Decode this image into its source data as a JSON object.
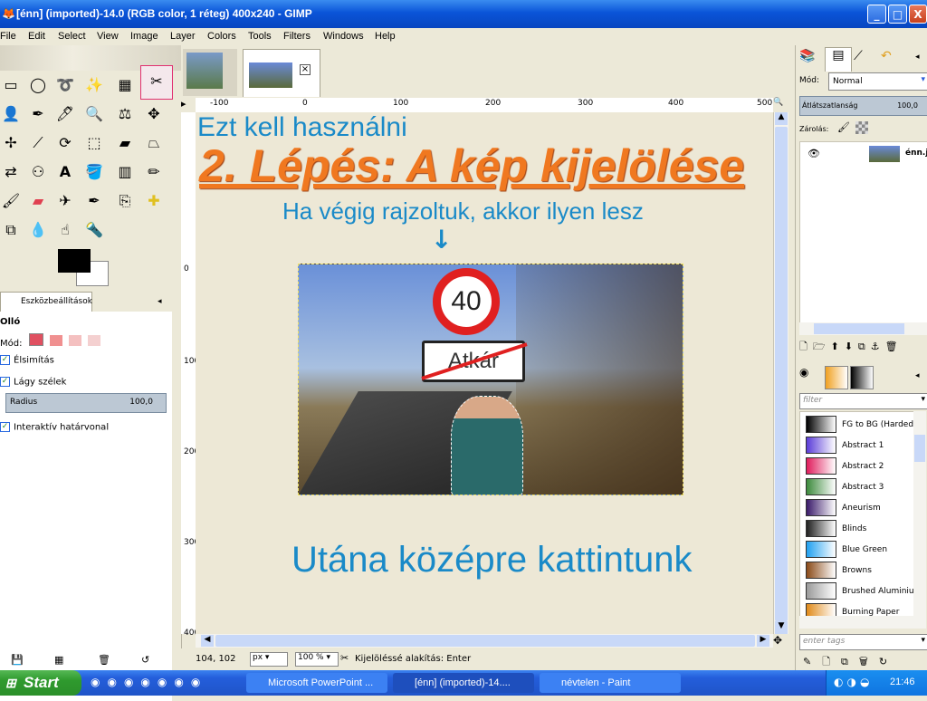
{
  "window": {
    "title": "[énn] (imported)-14.0 (RGB color, 1 réteg) 400x240 - GIMP",
    "buttons": [
      "_",
      "□",
      "X"
    ]
  },
  "menu": [
    "File",
    "Edit",
    "Select",
    "View",
    "Image",
    "Layer",
    "Colors",
    "Tools",
    "Filters",
    "Windows",
    "Help"
  ],
  "toolbox": {
    "tool_options_tab": "Eszközbeállítások",
    "tool_name": "Olló",
    "mode_label": "Mód:",
    "antialias_label": "Élsimítás",
    "feather_label": "Lágy szélek",
    "radius_label": "Radius",
    "radius_value": "100,0",
    "interactive_label": "Interaktív határvonal"
  },
  "ruler": {
    "h_ticks": [
      "-100",
      "0",
      "100",
      "200",
      "300",
      "400",
      "500"
    ],
    "v_ticks": [
      "0",
      "100",
      "200",
      "300",
      "400"
    ]
  },
  "slide": {
    "note_tool": "Ezt kell használni",
    "heading": "2. Lépés: A kép kijelölése",
    "subtext": "Ha végig rajzoltuk, akkor ilyen lesz",
    "arrow": "↓",
    "bottom_text": "Utána középre kattintunk",
    "sign_number": "40",
    "sign_town": "Atkár"
  },
  "statusbar": {
    "coords": "104, 102",
    "unit": "px",
    "zoom": "100 %",
    "message": "Kijelöléssé alakítás: Enter"
  },
  "layers": {
    "mode_label": "Mód:",
    "mode_value": "Normal",
    "opacity_label": "Átlátszatlanság",
    "opacity_value": "100,0",
    "lock_label": "Zárolás:",
    "layer_name": "énn.j"
  },
  "gradients": {
    "filter_placeholder": "filter",
    "tags_placeholder": "enter tags",
    "items": [
      {
        "name": "FG to BG (Hardedge)",
        "color": "#000000"
      },
      {
        "name": "Abstract 1",
        "color": "#5a3cd8"
      },
      {
        "name": "Abstract 2",
        "color": "#e01c5c"
      },
      {
        "name": "Abstract 3",
        "color": "#3c8a3c"
      },
      {
        "name": "Aneurism",
        "color": "#3a1a6a"
      },
      {
        "name": "Blinds",
        "color": "#202020"
      },
      {
        "name": "Blue Green",
        "color": "#20a0f0"
      },
      {
        "name": "Browns",
        "color": "#8a4a18"
      },
      {
        "name": "Brushed Aluminium",
        "color": "#9a9a9a"
      },
      {
        "name": "Burning Paper",
        "color": "#e08a1a"
      }
    ]
  },
  "taskbar": {
    "start": "Start",
    "tasks": [
      "Microsoft PowerPoint ...",
      "[énn] (imported)-14....",
      "névtelen - Paint"
    ],
    "clock": "21:46"
  },
  "colors": {
    "accent_orange": "#f07820",
    "slide_blue": "#1a8ac8",
    "xp_blue": "#0a54d8"
  }
}
